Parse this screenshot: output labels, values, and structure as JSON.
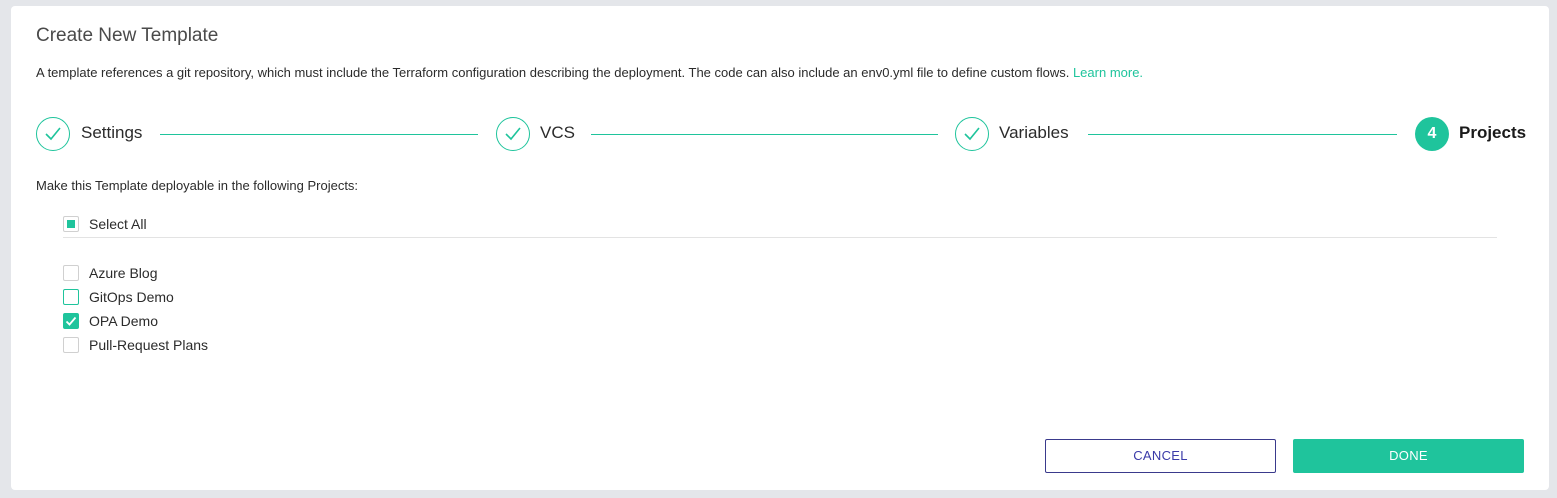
{
  "modal": {
    "title": "Create New Template",
    "description": "A template references a git repository, which must include the Terraform configuration describing the deployment. The code can also include an env0.yml file to define custom flows.",
    "learn_more": "Learn more."
  },
  "steps": [
    {
      "label": "Settings",
      "state": "done"
    },
    {
      "label": "VCS",
      "state": "done"
    },
    {
      "label": "Variables",
      "state": "done"
    },
    {
      "label": "Projects",
      "number": "4",
      "state": "active"
    }
  ],
  "projects": {
    "instruction": "Make this Template deployable in the following Projects:",
    "select_all": {
      "label": "Select All",
      "state": "indeterminate"
    },
    "items": [
      {
        "label": "Azure Blog",
        "checked": false
      },
      {
        "label": "GitOps Demo",
        "checked": false,
        "focused": true
      },
      {
        "label": "OPA Demo",
        "checked": true
      },
      {
        "label": "Pull-Request Plans",
        "checked": false
      }
    ]
  },
  "buttons": {
    "cancel": "CANCEL",
    "done": "DONE"
  },
  "colors": {
    "accent": "#1fc49c",
    "cancel_border": "#3a3a8c",
    "background": "#e4e6ea"
  }
}
